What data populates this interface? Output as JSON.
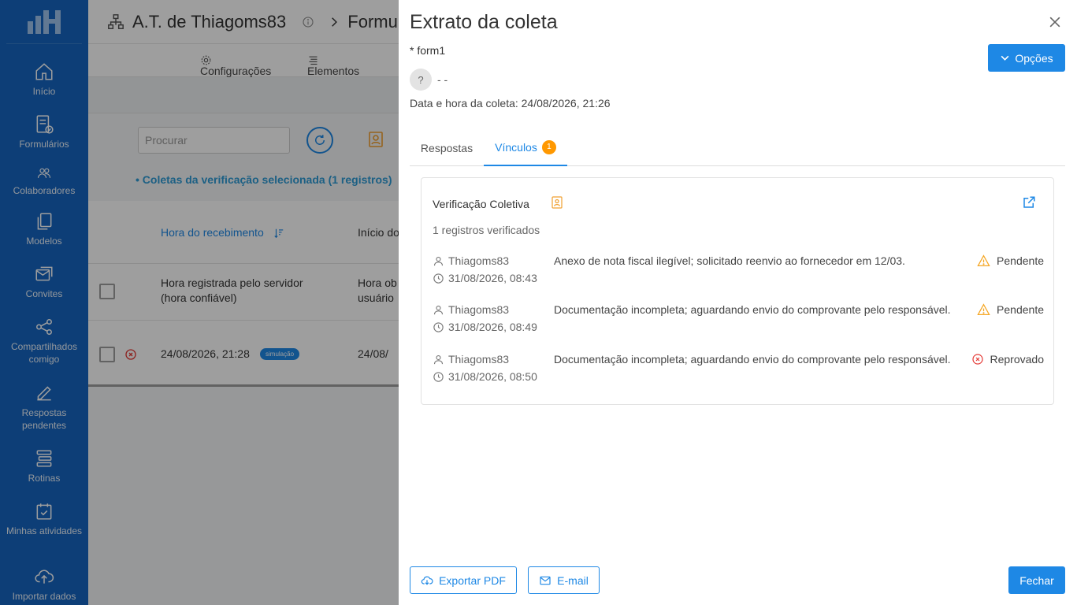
{
  "sidebar": {
    "items": [
      {
        "label": "Início",
        "icon": "home-icon"
      },
      {
        "label": "Formulários",
        "icon": "forms-icon"
      },
      {
        "label": "Colaboradores",
        "icon": "users-icon"
      },
      {
        "label": "Modelos",
        "icon": "copy-icon"
      },
      {
        "label": "Convites",
        "icon": "mail-icon"
      },
      {
        "label": "Compartilhados comigo",
        "icon": "share-icon"
      },
      {
        "label": "Respostas pendentes",
        "icon": "edit-icon"
      },
      {
        "label": "Rotinas",
        "icon": "list-icon"
      },
      {
        "label": "Minhas atividades",
        "icon": "calendar-check-icon"
      },
      {
        "label": "Importar dados",
        "icon": "cloud-upload-icon"
      }
    ]
  },
  "background": {
    "title": "A.T. de Thiagoms83",
    "breadcrumb_next": "Formulá",
    "toolbar": {
      "config": "Configurações",
      "elements": "Elementos"
    },
    "search_placeholder": "Procurar",
    "filter_text": "Coletas da verificação selecionada (1 registros)",
    "table": {
      "col1_header": "Hora do recebimento",
      "col2_header": "Início do",
      "desc_col1": "Hora registrada pelo servidor (hora confiável)",
      "desc_col2": "Hora ob usuário",
      "row_value1": "24/08/2026, 21:28",
      "row_badge": "simulação",
      "row_value2": "24/08/"
    }
  },
  "drawer": {
    "title": "Extrato da coleta",
    "form_name": "* form1",
    "avatar_letter": "?",
    "avatar_name": "- -",
    "date_line": "Data e hora da coleta: 24/08/2026, 21:26",
    "opcoes_label": "Opções",
    "tabs": {
      "respostas": "Respostas",
      "vinculos": "Vínculos",
      "vinculos_badge": "1"
    },
    "card": {
      "title": "Verificação Coletiva",
      "count": "1 registros verificados",
      "records": [
        {
          "user": "Thiagoms83",
          "time": "31/08/2026, 08:43",
          "desc": "Anexo de nota fiscal ilegível; solicitado reenvio ao fornecedor em 12/03.",
          "status": "Pendente",
          "status_icon": "warning-icon"
        },
        {
          "user": "Thiagoms83",
          "time": "31/08/2026, 08:49",
          "desc": "Documentação incompleta; aguardando envio do comprovante pelo responsável.",
          "status": "Pendente",
          "status_icon": "warning-icon"
        },
        {
          "user": "Thiagoms83",
          "time": "31/08/2026, 08:50",
          "desc": "Documentação incompleta; aguardando envio do comprovante pelo responsável.",
          "status": "Reprovado",
          "status_icon": "x-circle-icon"
        }
      ]
    },
    "footer": {
      "export_pdf": "Exportar PDF",
      "email": "E-mail",
      "close": "Fechar"
    }
  },
  "colors": {
    "sidebar": "#1565c0",
    "accent": "#1e88e5",
    "warning": "#f5a623",
    "danger": "#e53935",
    "badge": "#ff9800"
  }
}
